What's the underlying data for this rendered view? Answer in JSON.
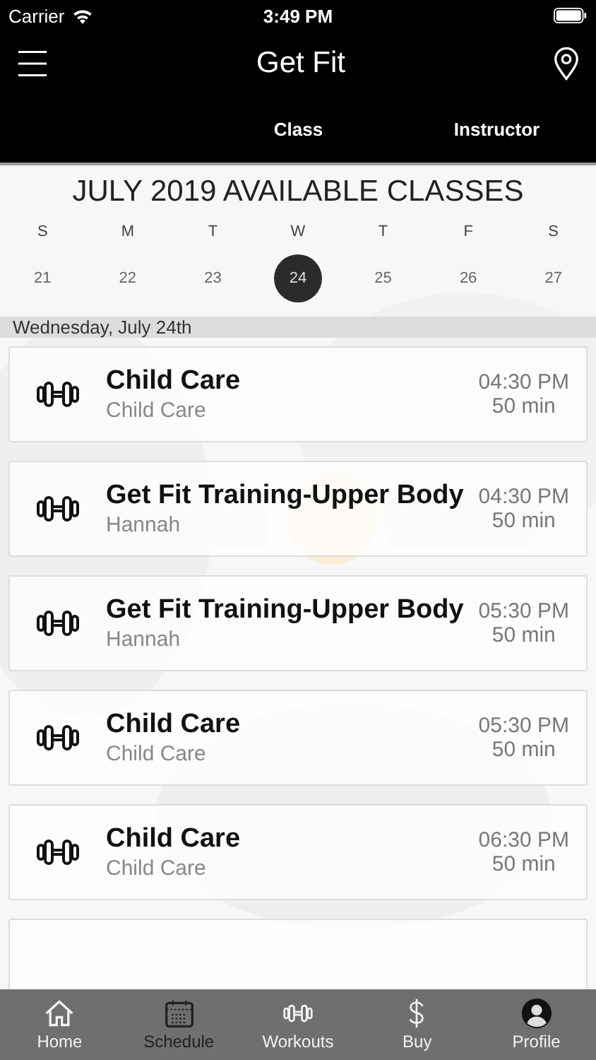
{
  "status_bar": {
    "carrier": "Carrier",
    "time": "3:49 PM"
  },
  "nav_bar": {
    "title": "Get Fit"
  },
  "tabs": [
    {
      "label": "Class"
    },
    {
      "label": "Instructor"
    }
  ],
  "calendar": {
    "title": "JULY 2019 AVAILABLE CLASSES",
    "days": [
      {
        "weekday": "S",
        "date": "21",
        "selected": false
      },
      {
        "weekday": "M",
        "date": "22",
        "selected": false
      },
      {
        "weekday": "T",
        "date": "23",
        "selected": false
      },
      {
        "weekday": "W",
        "date": "24",
        "selected": true
      },
      {
        "weekday": "T",
        "date": "25",
        "selected": false
      },
      {
        "weekday": "F",
        "date": "26",
        "selected": false
      },
      {
        "weekday": "S",
        "date": "27",
        "selected": false
      }
    ]
  },
  "day_header": "Wednesday, July 24th",
  "classes": [
    {
      "name": "Child Care",
      "instructor": "Child Care",
      "time": "04:30 PM",
      "duration": "50 min"
    },
    {
      "name": "Get Fit Training-Upper Body",
      "instructor": "Hannah",
      "time": "04:30 PM",
      "duration": "50 min"
    },
    {
      "name": "Get Fit Training-Upper Body",
      "instructor": "Hannah",
      "time": "05:30 PM",
      "duration": "50 min"
    },
    {
      "name": "Child Care",
      "instructor": "Child Care",
      "time": "05:30 PM",
      "duration": "50 min"
    },
    {
      "name": "Child Care",
      "instructor": "Child Care",
      "time": "06:30 PM",
      "duration": "50 min"
    }
  ],
  "tab_bar": [
    {
      "kind": "home",
      "label": "Home",
      "selected": false
    },
    {
      "kind": "schedule",
      "label": "Schedule",
      "selected": true
    },
    {
      "kind": "workouts",
      "label": "Workouts",
      "selected": false
    },
    {
      "kind": "buy",
      "label": "Buy",
      "selected": false
    },
    {
      "kind": "profile",
      "label": "Profile",
      "selected": false
    }
  ]
}
